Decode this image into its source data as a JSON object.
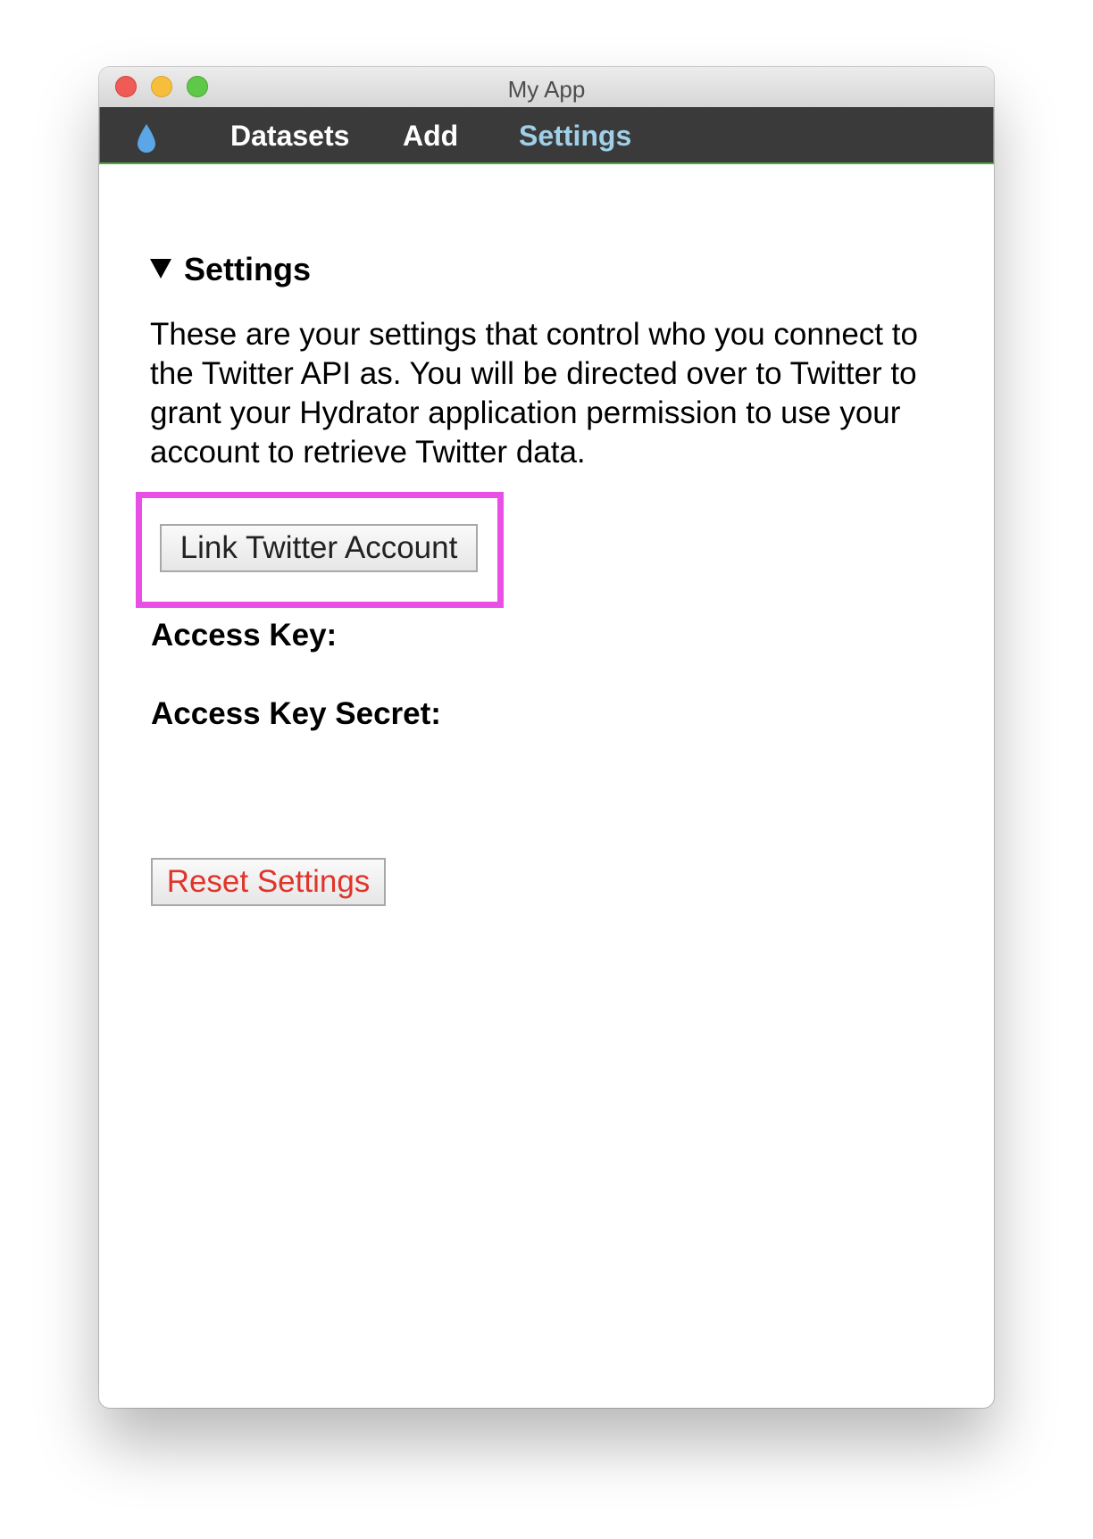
{
  "window": {
    "title": "My App"
  },
  "nav": {
    "logo_icon": "water-drop-icon",
    "items": [
      {
        "label": "Datasets",
        "active": false
      },
      {
        "label": "Add",
        "active": false
      },
      {
        "label": "Settings",
        "active": true
      }
    ]
  },
  "settings": {
    "heading": "Settings",
    "description": "These are your settings that control who you connect to the Twitter API as. You will be directed over to Twitter to grant your Hydrator application permission to use your account to retrieve Twitter data.",
    "link_button": "Link Twitter Account",
    "access_key_label": "Access Key:",
    "access_key_secret_label": "Access Key Secret:",
    "reset_button": "Reset Settings"
  },
  "colors": {
    "nav_background": "#3a3a3a",
    "nav_active": "#9fd0e8",
    "highlight": "#e94fe6",
    "reset_text": "#e0342a"
  }
}
